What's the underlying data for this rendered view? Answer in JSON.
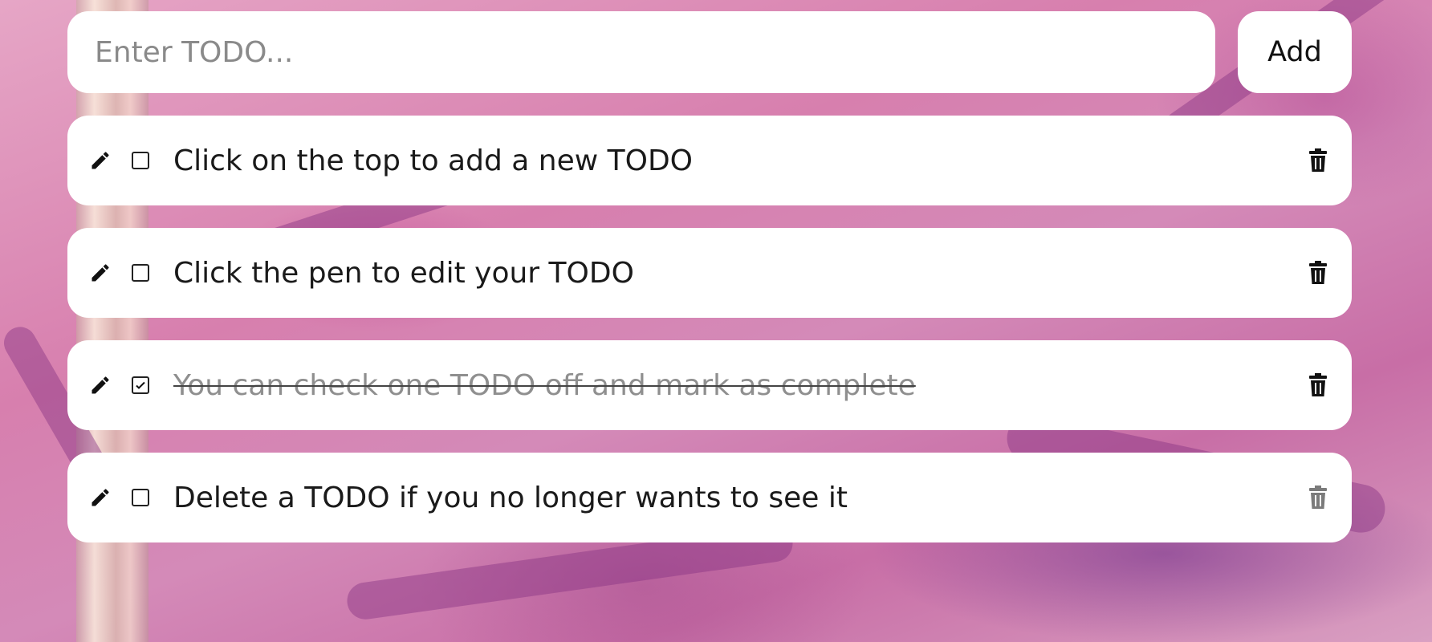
{
  "input": {
    "placeholder": "Enter TODO...",
    "value": ""
  },
  "add_button": {
    "label": "Add"
  },
  "todos": [
    {
      "text": "Click on the top to add a new TODO",
      "completed": false
    },
    {
      "text": "Click the pen to edit your TODO",
      "completed": false
    },
    {
      "text": "You can check one TODO off and mark as complete",
      "completed": true
    },
    {
      "text": "Delete a TODO if you no longer wants to see it",
      "completed": false
    }
  ],
  "icons": {
    "edit": "pencil-icon",
    "checkbox": "checkbox-icon",
    "delete": "trash-icon"
  },
  "colors": {
    "card": "#ffffff",
    "text": "#1a1a1a",
    "completed_text": "#8f8f8f",
    "background_accent": "#d77fae"
  }
}
